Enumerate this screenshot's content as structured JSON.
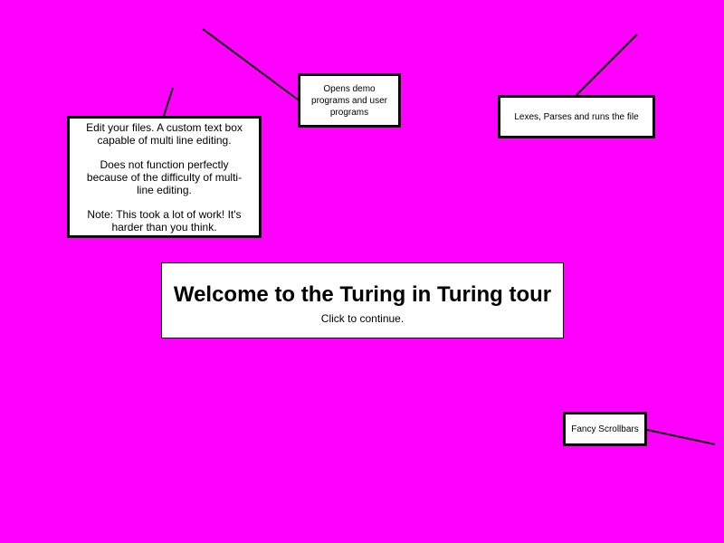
{
  "page": {
    "background_color": "#ff00ff"
  },
  "tour": {
    "welcome": {
      "title": "Welcome to the Turing in Turing tour",
      "subtitle": "Click to continue."
    },
    "callouts": {
      "open_programs": {
        "text": "Opens demo programs and user programs"
      },
      "run_file": {
        "text": "Lexes, Parses and runs the file"
      },
      "editor": {
        "paragraph_1": "Edit your files. A custom text box capable of multi line editing.",
        "paragraph_2": "Does not function perfectly because of the difficulty of multi-line editing.",
        "paragraph_3": "Note: This took a lot of work! It's harder than you think."
      },
      "scrollbars": {
        "text": "Fancy Scrollbars"
      }
    }
  }
}
